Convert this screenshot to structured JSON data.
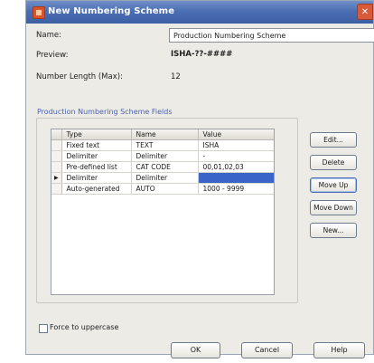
{
  "window": {
    "title": "New Numbering Scheme",
    "close_glyph": "✕"
  },
  "form": {
    "name_label": "Name:",
    "name_value": "Production Numbering Scheme",
    "preview_label": "Preview:",
    "preview_value": "ISHA-??-####",
    "length_label": "Number Length (Max):",
    "length_value": "12"
  },
  "fields_group": {
    "title": "Production Numbering Scheme Fields",
    "columns": [
      "Type",
      "Name",
      "Value"
    ],
    "rows": [
      {
        "type": "Fixed text",
        "name": "TEXT",
        "value": "ISHA",
        "current": false
      },
      {
        "type": "Delimiter",
        "name": "Delimiter",
        "value": "-",
        "current": false
      },
      {
        "type": "Pre-defined list",
        "name": "CAT CODE",
        "value": "00,01,02,03",
        "current": false
      },
      {
        "type": "Delimiter",
        "name": "Delimiter",
        "value": "",
        "current": true
      },
      {
        "type": "Auto-generated",
        "name": "AUTO",
        "value": "1000 - 9999",
        "current": false
      }
    ],
    "current_row_marker": "▶"
  },
  "side_buttons": {
    "edit": "Edit...",
    "delete": "Delete",
    "move_up": "Move Up",
    "move_down": "Move Down",
    "new": "New..."
  },
  "footer": {
    "uppercase_label": "Force to uppercase",
    "ok": "OK",
    "cancel": "Cancel",
    "help": "Help"
  },
  "colors": {
    "titlebar": "#4c6fb3",
    "selection": "#3b64c8",
    "group_title": "#4a63b5"
  }
}
